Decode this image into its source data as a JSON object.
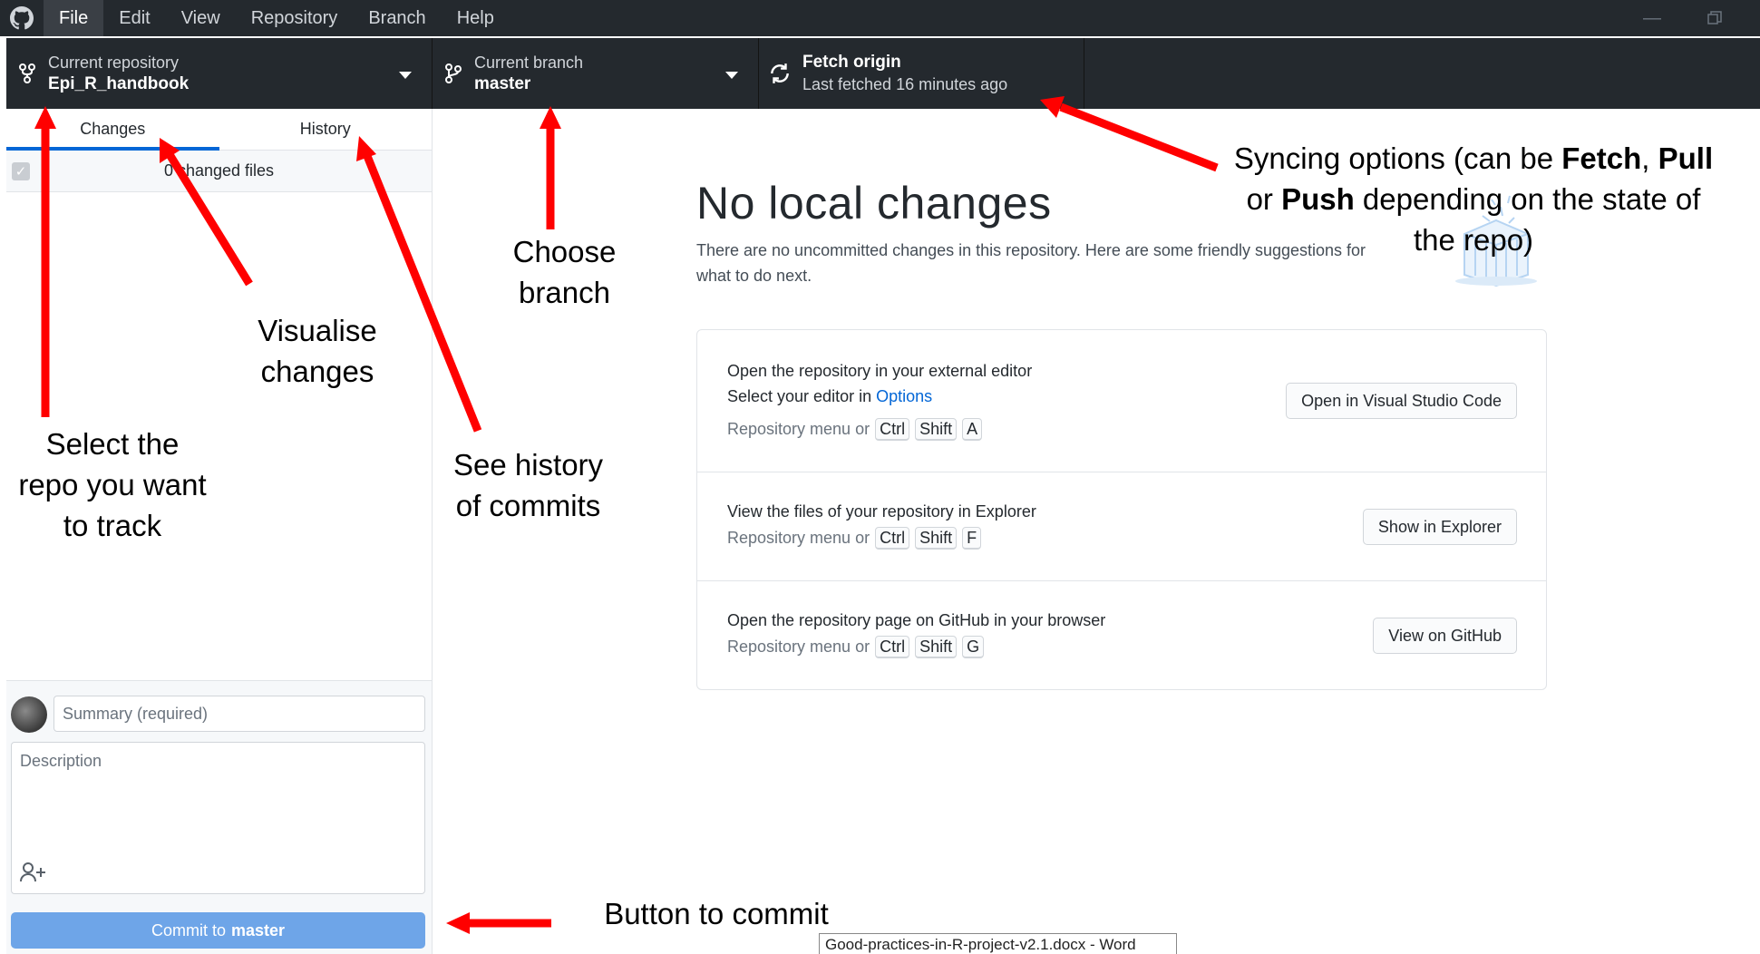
{
  "menu": {
    "logo_icon": "github-octocat-icon",
    "items": [
      "File",
      "Edit",
      "View",
      "Repository",
      "Branch",
      "Help"
    ]
  },
  "toolbar": {
    "repository": {
      "label": "Current repository",
      "value": "Epi_R_handbook"
    },
    "branch": {
      "label": "Current branch",
      "value": "master"
    },
    "fetch": {
      "label": "Fetch origin",
      "status": "Last fetched 16 minutes ago"
    }
  },
  "sidebar": {
    "tabs": [
      "Changes",
      "History"
    ],
    "changed_files": "0 changed files",
    "summary_placeholder": "Summary (required)",
    "description_placeholder": "Description",
    "commit_label": "Commit to",
    "commit_branch": "master"
  },
  "main": {
    "title": "No local changes",
    "description": "There are no uncommitted changes in this repository. Here are some friendly suggestions for what to do next.",
    "actions": [
      {
        "title": "Open the repository in your external editor",
        "subtitle_prefix": "Select your editor in",
        "subtitle_link": "Options",
        "shortcut_prefix": "Repository menu or",
        "keys": [
          "Ctrl",
          "Shift",
          "A"
        ],
        "button": "Open in Visual Studio Code"
      },
      {
        "title": "View the files of your repository in Explorer",
        "shortcut_prefix": "Repository menu or",
        "keys": [
          "Ctrl",
          "Shift",
          "F"
        ],
        "button": "Show in Explorer"
      },
      {
        "title": "Open the repository page on GitHub in your browser",
        "shortcut_prefix": "Repository menu or",
        "keys": [
          "Ctrl",
          "Shift",
          "G"
        ],
        "button": "View on GitHub"
      }
    ]
  },
  "annotations": {
    "syncing": [
      "Syncing options (can be ",
      "Fetch",
      ", ",
      "Pull",
      " or ",
      "Push",
      " depending on the state of the repo)"
    ],
    "choose_branch": "Choose branch",
    "visualise_changes": "Visualise changes",
    "select_repo": "Select the repo you want to track",
    "see_history": "See history of commits",
    "button_to_commit": "Button to commit",
    "arrow_color": "#ff0000"
  },
  "taskbar_tooltip": "Good-practices-in-R-project-v2.1.docx - Word"
}
